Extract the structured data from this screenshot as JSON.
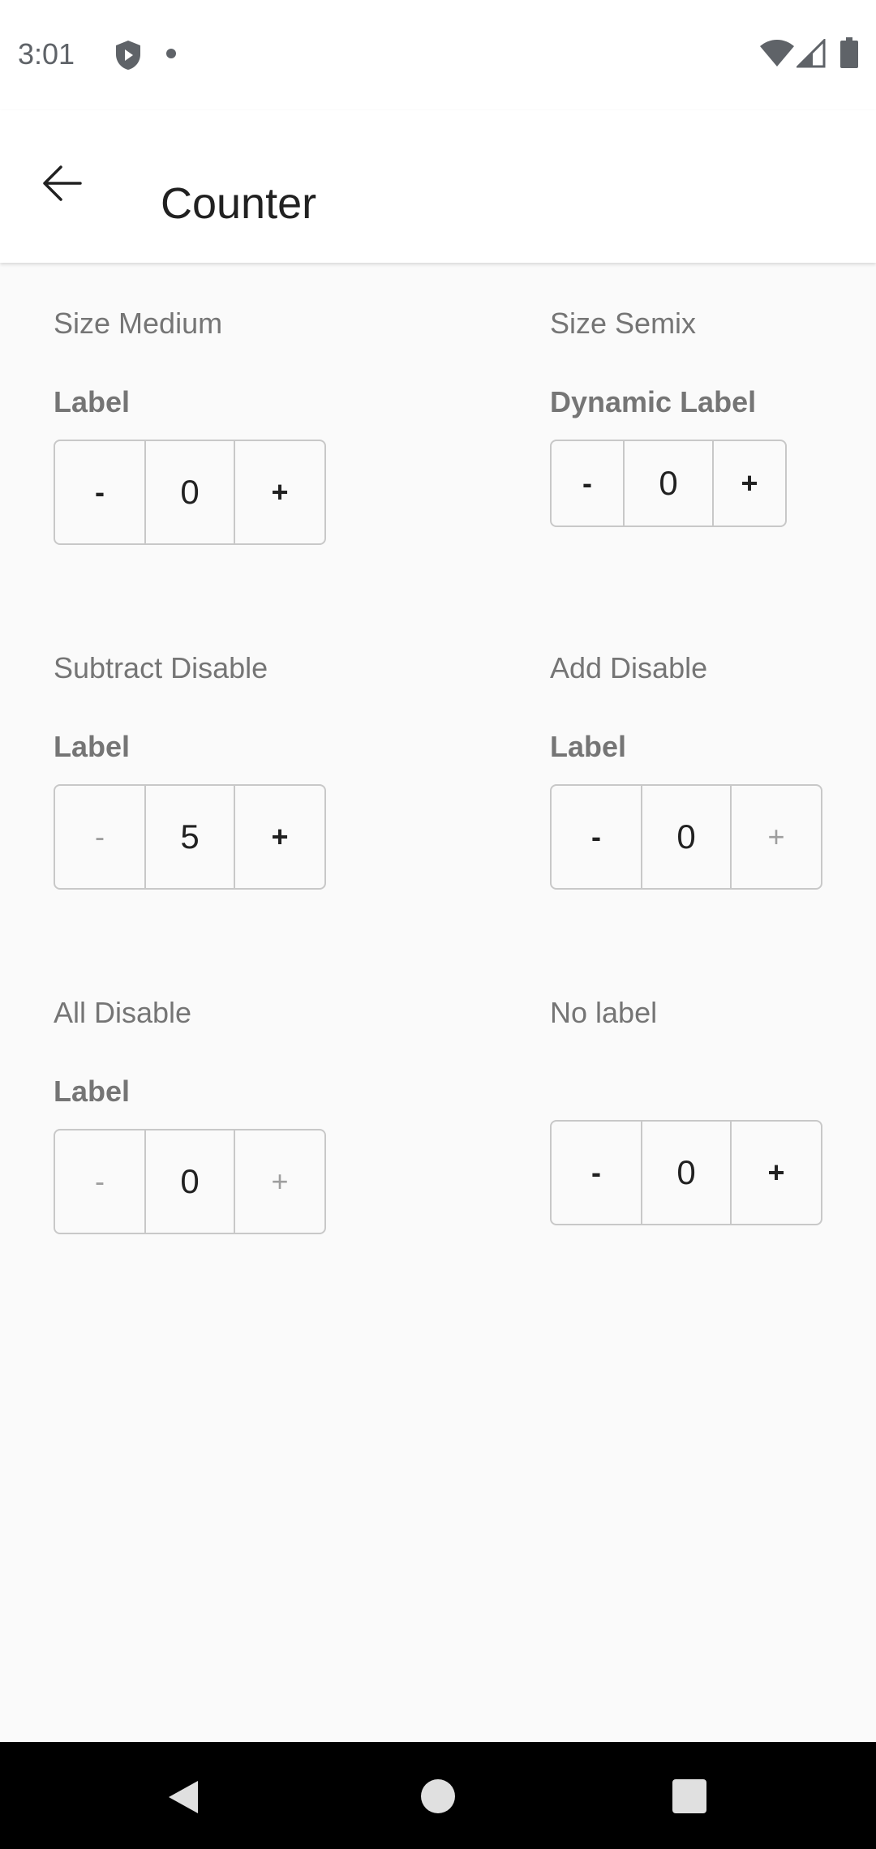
{
  "status_bar": {
    "time": "3:01",
    "icons": [
      "shield-icon",
      "notification-dot-icon",
      "wifi-icon",
      "signal-icon",
      "battery-icon"
    ]
  },
  "app_bar": {
    "back_icon": "arrow-back-icon",
    "title": "Counter"
  },
  "sections": {
    "size_medium": {
      "title": "Size Medium",
      "label": "Label",
      "minus": "-",
      "value": "0",
      "plus": "+",
      "minus_enabled": true,
      "plus_enabled": true
    },
    "size_semix": {
      "title": "Size Semix",
      "label": "Dynamic Label",
      "minus": "-",
      "value": "0",
      "plus": "+",
      "minus_enabled": true,
      "plus_enabled": true
    },
    "subtract_disable": {
      "title": "Subtract Disable",
      "label": "Label",
      "minus": "-",
      "value": "5",
      "plus": "+",
      "minus_enabled": false,
      "plus_enabled": true
    },
    "add_disable": {
      "title": "Add Disable",
      "label": "Label",
      "minus": "-",
      "value": "0",
      "plus": "+",
      "minus_enabled": true,
      "plus_enabled": false
    },
    "all_disable": {
      "title": "All Disable",
      "label": "Label",
      "minus": "-",
      "value": "0",
      "plus": "+",
      "minus_enabled": false,
      "plus_enabled": false
    },
    "no_label": {
      "title": "No label",
      "minus": "-",
      "value": "0",
      "plus": "+",
      "minus_enabled": true,
      "plus_enabled": true
    }
  },
  "colors": {
    "background": "#fafafa",
    "app_bar": "#ffffff",
    "border": "#c8c8c8",
    "secondary_text": "#757575",
    "disabled_text": "#9e9e9e",
    "nav_bar": "#000000"
  },
  "nav_bar": {
    "icons": [
      "nav-back-icon",
      "nav-home-icon",
      "nav-recents-icon"
    ]
  }
}
